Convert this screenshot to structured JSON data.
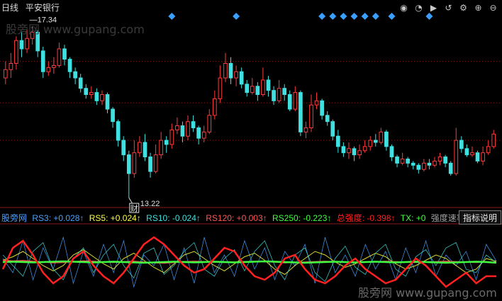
{
  "header": {
    "period": "日线",
    "stock_name": "平安银行"
  },
  "toolbar": {
    "icons": [
      "eye-icon",
      "clock-icon",
      "play-icon",
      "refresh-icon",
      "settings-icon",
      "plus-icon",
      "minus-icon"
    ],
    "glyphs": [
      "◉",
      "◔",
      "▶",
      "↺",
      "⚙",
      "⊕",
      "⊖"
    ]
  },
  "watermarks": {
    "top": "股旁网 www.gupang.com",
    "bottom": "股旁网 www.gupang.com"
  },
  "indicator": {
    "name": "股旁网",
    "rs3": "RS3: +0.028↑",
    "rs5": "RS5: +0.024↑",
    "rs10": "RS10: -0.024↑",
    "rs120": "RS120: +0.003↑",
    "rs250": "RS250: -0.223↑",
    "total": "总强度: -0.398↑",
    "tx": "TX: +0",
    "speed": "强度速率三",
    "explain_button": "指标说明"
  },
  "colors": {
    "up": "#ff3b3b",
    "down": "#40e0e0",
    "marker": "#3aa0ff",
    "grid": "#8a1a1a",
    "rs3": "#4aa0ff",
    "rs5": "#ffff40",
    "rs10": "#40e0e0",
    "rs120": "#ff5555",
    "rs250": "#40ff40",
    "total": "#ff2020",
    "tx": "#40ff40",
    "speed": "#a0a0a0"
  },
  "chart_data": [
    {
      "type": "candlestick",
      "title": "平安银行 日线",
      "annotations": {
        "high_label": "17.34",
        "low_label": "13.22",
        "finance_marker": "财"
      },
      "ylim": [
        13.0,
        17.6
      ],
      "marker_positions": [
        31,
        43,
        59,
        61,
        63,
        65,
        67,
        69,
        72,
        79
      ],
      "candles": [
        [
          16.1,
          16.3,
          16.5,
          15.95
        ],
        [
          16.3,
          16.45,
          16.7,
          16.1
        ],
        [
          16.45,
          17.0,
          17.1,
          16.3
        ],
        [
          17.0,
          16.8,
          17.2,
          16.6
        ],
        [
          16.8,
          17.05,
          17.25,
          16.7
        ],
        [
          17.05,
          17.2,
          17.34,
          16.9
        ],
        [
          17.2,
          16.75,
          17.25,
          16.6
        ],
        [
          16.75,
          16.25,
          16.85,
          16.1
        ],
        [
          16.25,
          16.35,
          16.5,
          16.15
        ],
        [
          16.35,
          16.4,
          16.6,
          16.2
        ],
        [
          16.4,
          16.8,
          16.95,
          16.35
        ],
        [
          16.8,
          16.55,
          16.9,
          16.4
        ],
        [
          16.55,
          16.25,
          16.6,
          16.1
        ],
        [
          16.25,
          16.1,
          16.35,
          15.95
        ],
        [
          16.1,
          15.85,
          16.2,
          15.75
        ],
        [
          15.85,
          15.7,
          15.95,
          15.6
        ],
        [
          15.7,
          15.75,
          15.9,
          15.6
        ],
        [
          15.75,
          15.55,
          15.85,
          15.45
        ],
        [
          15.55,
          15.7,
          15.8,
          15.45
        ],
        [
          15.7,
          15.35,
          15.75,
          15.25
        ],
        [
          15.35,
          15.05,
          15.4,
          14.9
        ],
        [
          15.05,
          14.6,
          15.1,
          14.45
        ],
        [
          14.6,
          14.25,
          14.7,
          14.1
        ],
        [
          14.25,
          13.8,
          14.35,
          13.22
        ],
        [
          13.8,
          14.3,
          14.6,
          13.7
        ],
        [
          14.3,
          14.55,
          14.7,
          14.2
        ],
        [
          14.55,
          14.2,
          14.75,
          14.1
        ],
        [
          14.2,
          13.85,
          14.3,
          13.7
        ],
        [
          13.85,
          14.25,
          14.5,
          13.8
        ],
        [
          14.25,
          14.6,
          14.8,
          14.15
        ],
        [
          14.6,
          14.5,
          14.7,
          14.3
        ],
        [
          14.5,
          14.85,
          15.0,
          14.4
        ],
        [
          14.85,
          14.95,
          15.15,
          14.75
        ],
        [
          14.95,
          14.7,
          15.05,
          14.55
        ],
        [
          14.7,
          15.05,
          15.2,
          14.6
        ],
        [
          15.05,
          14.9,
          15.2,
          14.8
        ],
        [
          14.9,
          14.65,
          14.95,
          14.5
        ],
        [
          14.65,
          14.8,
          14.95,
          14.55
        ],
        [
          14.8,
          15.2,
          15.35,
          14.75
        ],
        [
          15.2,
          15.6,
          15.8,
          15.1
        ],
        [
          15.6,
          16.1,
          16.4,
          15.5
        ],
        [
          16.1,
          16.45,
          16.7,
          16.0
        ],
        [
          16.45,
          16.1,
          16.6,
          15.95
        ],
        [
          16.1,
          16.25,
          16.4,
          15.9
        ],
        [
          16.25,
          15.95,
          16.35,
          15.85
        ],
        [
          15.95,
          15.75,
          16.05,
          15.65
        ],
        [
          15.75,
          15.9,
          16.1,
          15.7
        ],
        [
          15.9,
          15.7,
          16.0,
          15.55
        ],
        [
          15.7,
          16.05,
          16.35,
          15.65
        ],
        [
          16.05,
          15.8,
          16.15,
          15.65
        ],
        [
          15.8,
          15.55,
          15.9,
          15.45
        ],
        [
          15.55,
          15.85,
          16.05,
          15.5
        ],
        [
          15.85,
          15.7,
          15.95,
          15.55
        ],
        [
          15.7,
          15.35,
          15.8,
          15.3
        ],
        [
          15.35,
          15.75,
          15.9,
          15.3
        ],
        [
          15.75,
          14.8,
          15.8,
          14.7
        ],
        [
          14.8,
          14.9,
          15.05,
          14.65
        ],
        [
          14.9,
          15.45,
          15.7,
          14.8
        ],
        [
          15.45,
          15.55,
          15.75,
          15.35
        ],
        [
          15.55,
          15.2,
          15.6,
          15.1
        ],
        [
          15.2,
          15.05,
          15.3,
          14.95
        ],
        [
          15.05,
          14.7,
          15.1,
          14.6
        ],
        [
          14.7,
          14.45,
          14.85,
          14.3
        ],
        [
          14.45,
          14.3,
          14.55,
          14.2
        ],
        [
          14.3,
          14.4,
          14.55,
          14.15
        ],
        [
          14.4,
          14.25,
          14.45,
          14.1
        ],
        [
          14.25,
          14.35,
          14.5,
          14.15
        ],
        [
          14.35,
          14.45,
          14.6,
          14.3
        ],
        [
          14.45,
          14.6,
          14.7,
          14.35
        ],
        [
          14.6,
          14.55,
          14.75,
          14.45
        ],
        [
          14.55,
          14.8,
          14.9,
          14.5
        ],
        [
          14.8,
          14.45,
          14.85,
          14.35
        ],
        [
          14.45,
          14.2,
          14.5,
          14.1
        ],
        [
          14.2,
          14.05,
          14.25,
          13.95
        ],
        [
          14.05,
          14.15,
          14.3,
          14.0
        ],
        [
          14.15,
          14.05,
          14.2,
          13.95
        ],
        [
          14.05,
          14.0,
          14.1,
          13.9
        ],
        [
          14.0,
          13.9,
          14.05,
          13.8
        ],
        [
          13.9,
          14.05,
          14.15,
          13.85
        ],
        [
          14.05,
          14.0,
          14.15,
          13.9
        ],
        [
          14.0,
          14.1,
          14.2,
          13.95
        ],
        [
          14.1,
          14.2,
          14.3,
          14.0
        ],
        [
          14.2,
          14.05,
          14.25,
          13.95
        ],
        [
          14.05,
          13.8,
          14.1,
          13.75
        ],
        [
          13.8,
          14.6,
          14.9,
          13.75
        ],
        [
          14.6,
          14.4,
          14.7,
          14.3
        ],
        [
          14.4,
          14.25,
          14.5,
          14.2
        ],
        [
          14.25,
          14.3,
          14.45,
          14.2
        ],
        [
          14.3,
          14.1,
          14.35,
          14.05
        ],
        [
          14.1,
          14.3,
          14.45,
          14.0
        ],
        [
          14.3,
          14.45,
          14.6,
          14.25
        ],
        [
          14.45,
          14.75,
          14.85,
          14.4
        ]
      ]
    },
    {
      "type": "line",
      "title": "",
      "ylim": [
        -1.0,
        1.0
      ],
      "series": [
        {
          "name": "RS3",
          "values": [
            0.1,
            -0.3,
            0.6,
            -0.5,
            0.4,
            -0.2,
            0.7,
            -0.6,
            0.3,
            -0.4,
            0.5,
            -0.3,
            0.6,
            -0.7,
            0.2,
            -0.1,
            0.5,
            -0.5,
            0.4,
            -0.6,
            0.7,
            -0.3,
            0.2,
            -0.4,
            0.6,
            -0.2,
            0.4,
            -0.5,
            0.3,
            -0.1,
            0.5,
            -0.6,
            0.7,
            -0.3,
            0.2,
            -0.4,
            0.5,
            -0.2,
            0.3,
            -0.5,
            0.4,
            -0.3,
            0.6,
            -0.4,
            0.2,
            -0.1,
            0.3,
            -0.5,
            0.5,
            0.03
          ]
        },
        {
          "name": "RS5",
          "values": [
            0.05,
            0.15,
            0.3,
            0.1,
            -0.1,
            -0.25,
            -0.1,
            0.2,
            0.35,
            0.15,
            -0.05,
            -0.2,
            0.1,
            0.25,
            0.05,
            -0.15,
            -0.3,
            -0.05,
            0.2,
            0.3,
            0.1,
            -0.1,
            -0.25,
            -0.05,
            0.15,
            0.25,
            0.05,
            -0.2,
            -0.35,
            -0.1,
            0.1,
            0.3,
            0.2,
            0.0,
            -0.15,
            -0.05,
            0.1,
            0.25,
            0.15,
            -0.05,
            -0.2,
            -0.1,
            0.05,
            0.2,
            0.1,
            -0.1,
            -0.3,
            -0.2,
            0.1,
            0.02
          ]
        },
        {
          "name": "RS10",
          "values": [
            0.2,
            -0.1,
            -0.4,
            0.3,
            0.55,
            -0.2,
            -0.5,
            0.1,
            0.4,
            -0.3,
            0.2,
            0.5,
            -0.1,
            -0.45,
            0.25,
            0.4,
            -0.35,
            -0.1,
            0.3,
            0.55,
            -0.2,
            -0.4,
            0.1,
            0.35,
            -0.25,
            0.3,
            0.6,
            -0.1,
            -0.5,
            0.2,
            0.4,
            -0.3,
            -0.55,
            0.1,
            0.45,
            -0.15,
            -0.35,
            0.25,
            0.5,
            -0.2,
            -0.4,
            0.15,
            0.35,
            -0.1,
            0.4,
            0.55,
            -0.2,
            -0.3,
            0.2,
            -0.02
          ]
        },
        {
          "name": "RS120",
          "values": [
            0.05,
            0.03,
            0.04,
            0.02,
            0.0,
            -0.02,
            -0.01,
            0.01,
            0.03,
            0.02,
            0.0,
            -0.01,
            0.01,
            0.02,
            0.0,
            -0.02,
            -0.03,
            -0.01,
            0.01,
            0.02,
            0.01,
            0.0,
            -0.01,
            0.0,
            0.01,
            0.02,
            0.01,
            0.0,
            -0.02,
            -0.01,
            0.0,
            0.01,
            0.02,
            0.01,
            0.0,
            -0.01,
            0.0,
            0.01,
            0.02,
            0.01,
            0.0,
            -0.01,
            0.0,
            0.01,
            0.02,
            0.01,
            0.0,
            -0.01,
            0.0,
            0.0
          ]
        },
        {
          "name": "RS250",
          "values": [
            0.0,
            0.01,
            0.0,
            -0.01,
            0.0,
            0.01,
            0.02,
            0.01,
            0.0,
            -0.01,
            0.0,
            0.01,
            0.0,
            -0.01,
            -0.02,
            -0.01,
            0.0,
            0.01,
            0.0,
            -0.01,
            0.0,
            0.01,
            0.0,
            -0.01,
            0.0,
            0.01,
            0.02,
            0.01,
            0.0,
            -0.01,
            -0.02,
            -0.01,
            0.0,
            0.01,
            0.0,
            -0.01,
            0.0,
            0.01,
            0.0,
            -0.01,
            0.0,
            0.01,
            0.0,
            -0.01,
            -0.02,
            -0.01,
            0.0,
            0.01,
            0.0,
            -0.02
          ]
        },
        {
          "name": "总强度",
          "values": [
            -0.2,
            0.4,
            0.6,
            0.2,
            -0.3,
            -0.6,
            -0.4,
            0.1,
            0.3,
            -0.1,
            -0.4,
            -0.6,
            -0.3,
            0.1,
            0.5,
            0.7,
            0.5,
            0.2,
            -0.1,
            -0.3,
            -0.2,
            0.1,
            0.4,
            0.3,
            -0.1,
            -0.4,
            -0.5,
            -0.3,
            0.1,
            0.2,
            -0.2,
            -0.5,
            -0.6,
            -0.4,
            -0.1,
            0.1,
            -0.2,
            -0.4,
            -0.6,
            -0.5,
            -0.2,
            0.1,
            -0.1,
            -0.4,
            -0.7,
            -0.5,
            -0.3,
            -0.6,
            -0.4,
            -0.4
          ]
        }
      ]
    }
  ]
}
